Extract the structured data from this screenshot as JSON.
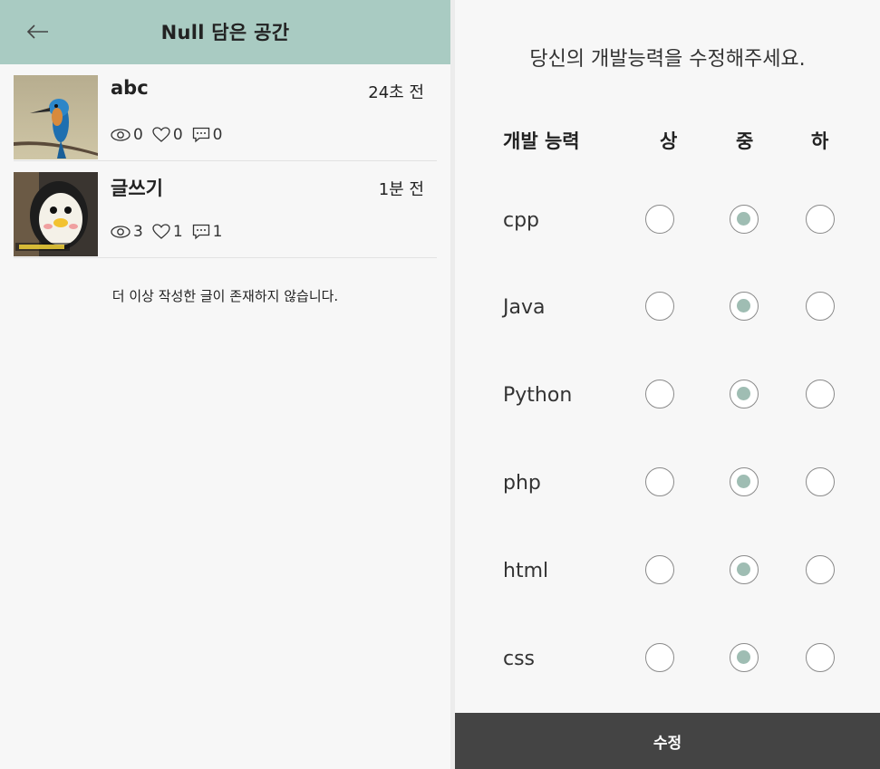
{
  "header": {
    "title": "Null 담은 공간",
    "back_icon": "arrow-left-icon",
    "color": "#a9cbc2"
  },
  "posts": [
    {
      "title": "abc",
      "time": "24초 전",
      "views": "0",
      "likes": "0",
      "comments": "0",
      "thumbnail": "kingfisher-bird-photo"
    },
    {
      "title": "글쓰기",
      "time": "1분 전",
      "views": "3",
      "likes": "1",
      "comments": "1",
      "thumbnail": "pengsoo-character-photo"
    }
  ],
  "end_message": "더 이상 작성한 글이 존재하지 않습니다.",
  "skill_form": {
    "prompt": "당신의 개발능력을 수정해주세요.",
    "headers": [
      "개발 능력",
      "상",
      "중",
      "하"
    ],
    "rows": [
      {
        "label": "cpp",
        "selected": "중"
      },
      {
        "label": "Java",
        "selected": "중"
      },
      {
        "label": "Python",
        "selected": "중"
      },
      {
        "label": "php",
        "selected": "중"
      },
      {
        "label": "html",
        "selected": "중"
      },
      {
        "label": "css",
        "selected": "중"
      }
    ],
    "submit_label": "수정",
    "accent_color": "#9fbdb3",
    "button_color": "#444444"
  }
}
